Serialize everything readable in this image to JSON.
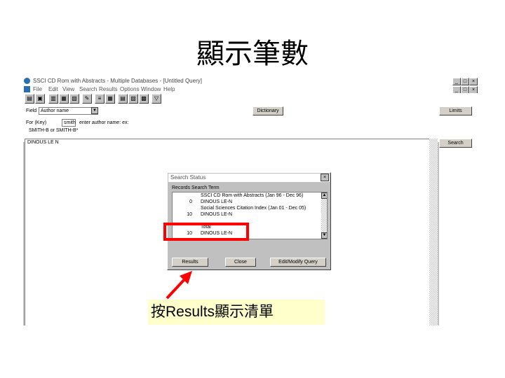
{
  "slide": {
    "title": "顯示筆數",
    "callout_text": "按Results顯示清單",
    "highlight_color": "#ff0000",
    "callout_bg": "#ffffcc"
  },
  "app": {
    "title": "SSCI CD Rom with Abstracts - Multiple Databases - [Untitled Query]",
    "window_controls": [
      "_",
      "□",
      "×"
    ],
    "menu": [
      "File",
      "Edit",
      "View",
      "Search",
      "Results",
      "Options",
      "Window",
      "Help"
    ],
    "toolbar_icons": [
      "open-icon",
      "save-icon",
      "print-icon",
      "copy-icon",
      "paste-icon",
      "edit-icon",
      "list-icon",
      "grid-icon",
      "table-icon",
      "export-icon",
      "import-icon",
      "filter-icon"
    ]
  },
  "search": {
    "field_label": "Field",
    "field_value": "Author name",
    "dictionary_label": "Dictionary",
    "limits_label": "Limits",
    "for_label": "For (Key)",
    "query_value": "smith",
    "query_hint": "enter author name: ex:",
    "example": "SMITH-B or SMITH-B*",
    "search_label": "Search",
    "results_text": "DINOUS LE N"
  },
  "dialog": {
    "title": "Search Status",
    "header": "Records  Search Term",
    "lines": [
      {
        "count": "",
        "text": "SSCI CD Rom with Abstracts (Jan 96 - Dec 96)"
      },
      {
        "count": "0",
        "text": "DINOUS LE-N"
      },
      {
        "count": "",
        "text": "Social Sciences Citation Index (Jan 01 - Dec 05)"
      },
      {
        "count": "10",
        "text": "DINOUS LE-N"
      },
      {
        "count": "",
        "text": ""
      },
      {
        "count": "",
        "text": "Total"
      },
      {
        "count": "10",
        "text": "DINOUS LE-N"
      }
    ],
    "results_button": "Results",
    "close_button": "Close",
    "edit_button": "Edit/Modify Query"
  }
}
